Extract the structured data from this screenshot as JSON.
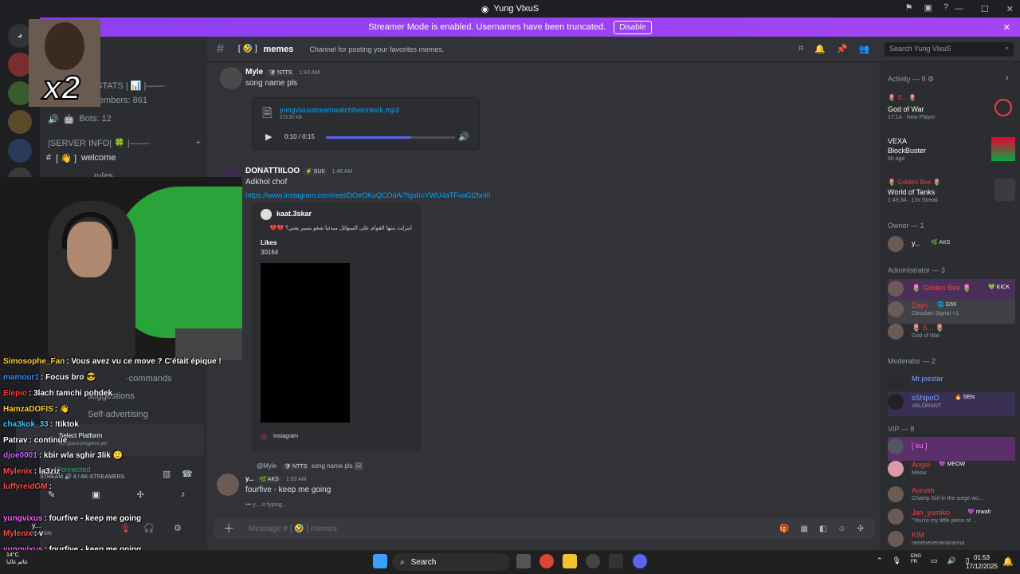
{
  "window": {
    "title": "Yung VlxuS"
  },
  "banner": {
    "text": "Streamer Mode is enabled. Usernames have been truncated.",
    "button": "Disable"
  },
  "sidebar": {
    "rows": [
      {
        "label": "R STATS | 📊 |——·"
      },
      {
        "label": "All Members: 861"
      },
      {
        "label": "Bots: 12"
      },
      {
        "label": "|SERVER INFO| 🍀 |——·"
      },
      {
        "label": "welcome"
      },
      {
        "label": "rules"
      },
      {
        "label": "·commands"
      },
      {
        "label": "suggestions"
      },
      {
        "label": "Self-advertising"
      }
    ],
    "quest": "Select Platform",
    "quest_sub": "No Quest progress yet",
    "voice_status": "Connected",
    "voice_channel": "STREAM 🔊 4 / AK-STREAMERS",
    "user": "y...",
    "user_status": "Invisible"
  },
  "header": {
    "channel": "memes",
    "prefix": "[ 🤣 ]",
    "topic": "Channel for posting your favorites memes.",
    "search_placeholder": "Search Yung VlxuS"
  },
  "messages": [
    {
      "user": "Myle",
      "tag": "🛡 NTTS",
      "time": "1:43 AM",
      "text": "song name pls"
    },
    {
      "user": "DONATTIILOO",
      "tag": "⚡ SUII",
      "time": "1:48 AM",
      "text": "Adkhol chof",
      "link": "https://www.instagram.com/reel/DOeOKuQCOdA/?igsh=YWU4aTFvaGl2bnl0"
    },
    {
      "user": "y...",
      "tag": "🌿 AKS",
      "time": "1:53 AM",
      "text": "fourfive - keep me going"
    }
  ],
  "audio": {
    "file": "yungvixusstreamwatchliveonkick.mp3",
    "size": "373.50 KB",
    "time": "0:10 / 0:15",
    "progress": 0.66
  },
  "embed": {
    "author": "kaat.3skar",
    "caption": "ابتزلت بنتها القوام على السوائل مبدئيا شفو يسير يعني؟ 💔💔",
    "likes_label": "Likes",
    "likes": "30164",
    "footer": "Instagram"
  },
  "reply": {
    "user": "@Myle",
    "tag": "🛡 NTTS",
    "text": "song name pls 🖼"
  },
  "typing": "y... is typing...",
  "composer": {
    "placeholder": "Message # [ 🤣 ] memes"
  },
  "members": {
    "activity": "Activity — 9",
    "activities": [
      {
        "name": "🌷 S... 🌷",
        "game": "God of War",
        "detail": "17:14 · New Player"
      },
      {
        "name": "VEXA",
        "game": "BlockBuster",
        "detail": "6h ago"
      },
      {
        "name": "🌷 Golden Bee 🌷",
        "game": "World of Tanks",
        "detail": "1:43:34 · 13x Streak"
      }
    ],
    "owner_head": "Owner — 1",
    "owner": [
      {
        "name": "y...",
        "tag": "🌿 AKS"
      }
    ],
    "admin_head": "Administrator — 3",
    "admins": [
      {
        "name": "🌷 Golden Bee 🌷",
        "tag": "💚 KICK"
      },
      {
        "name": "Zayn",
        "tag": "🌐 G59",
        "status": "Obsidian Signal +1"
      },
      {
        "name": "🌷 S... 🌷",
        "status": "God of War"
      }
    ],
    "mod_head": "Moderator — 2",
    "mods": [
      {
        "name": "Mr.joestar"
      },
      {
        "name": "sShipoO",
        "tag": "🔥 SEN",
        "status": "VALORANT"
      }
    ],
    "vip_head": "VIP — 8",
    "vips": [
      {
        "name": "[ ku ]"
      },
      {
        "name": "Angel",
        "tag": "💜 MEOW",
        "status": "Meow"
      },
      {
        "name": "Aurush",
        "status": "Champ Girl in the siege wo..."
      },
      {
        "name": "Jan_yumiko",
        "tag": "💜 mwah",
        "status": "\"You're my little piece of ..."
      },
      {
        "name": "KIM",
        "status": "nenenenenanananna"
      }
    ]
  },
  "overlay": {
    "multiplier": "x2"
  },
  "chat": [
    {
      "user": "Simosophe_Fan",
      "text": "Vous avez vu ce move ? C'était épique !",
      "color": "#ffd23c"
    },
    {
      "user": "mamour1",
      "text": "Focus bro 😎",
      "color": "#3c8cff"
    },
    {
      "user": "Elepio",
      "text": "3lach tamchi pohdek",
      "color": "#ff3c3c"
    },
    {
      "user": "HamzaDOFIS",
      "text": "👋",
      "color": "#ffd23c"
    },
    {
      "user": "cha3kok_33",
      "text": "!tiktok",
      "color": "#3cc8ff"
    },
    {
      "user": "Patrav",
      "text": "continue",
      "color": "#ffffff"
    },
    {
      "user": "djoe0001",
      "text": "kbir wla sghir 3lik 🙂",
      "color": "#c864ff"
    },
    {
      "user": "Mylenix",
      "text": "la3ziz",
      "color": "#ff5050"
    },
    {
      "user": "luffyreidGM",
      "text": "",
      "color": "#ff5050"
    },
    {
      "user": "yungvixus",
      "text": "fourfive - keep me going",
      "color": "#ff5aff"
    },
    {
      "user": "Mylenix",
      "text": "v",
      "color": "#ff5050"
    },
    {
      "user": "yungvixus",
      "text": "fourfive - keep me going",
      "color": "#ff5aff"
    }
  ],
  "taskbar": {
    "search": "Search",
    "time": "01:53",
    "date": "17/12/2025",
    "lang": "ENG",
    "lang2": "FR",
    "temp": "14°C",
    "weather": "غائم غالبا"
  }
}
